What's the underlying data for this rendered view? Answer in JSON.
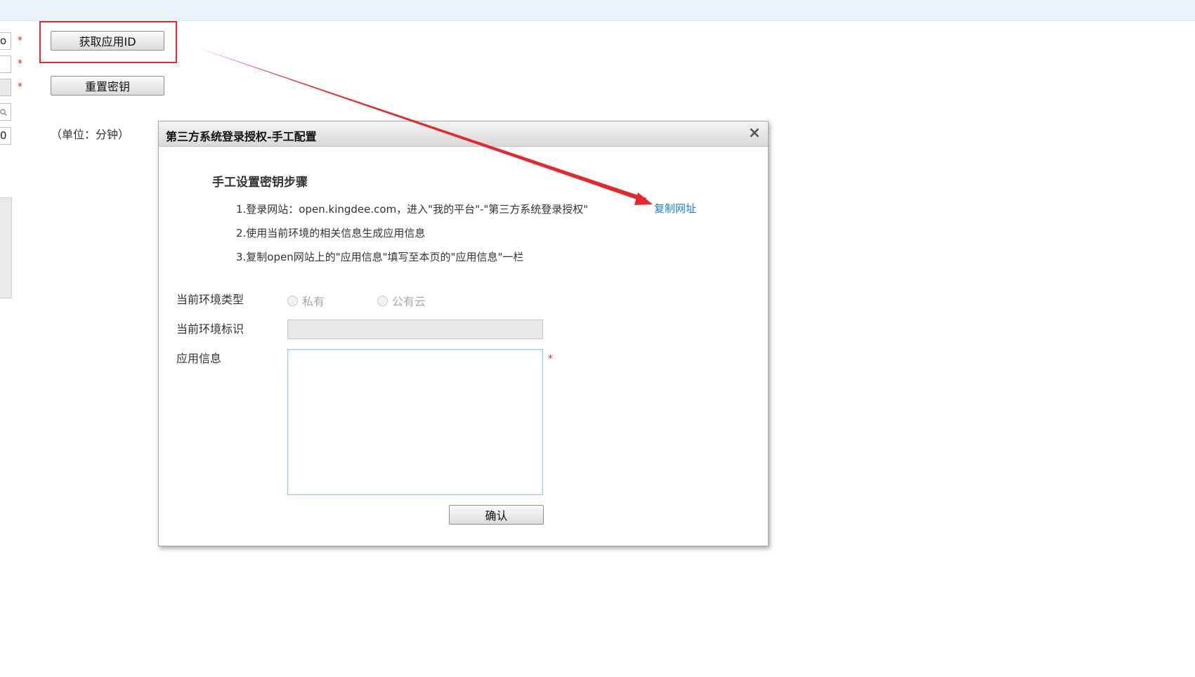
{
  "page": {
    "get_app_id_button": "获取应用ID",
    "reset_secret_button": "重置密钥",
    "unit_label": "（单位：分钟）",
    "stub_values": [
      "o",
      "",
      "",
      "",
      "0"
    ],
    "required_mark": "*"
  },
  "dialog": {
    "title": "第三方系统登录授权-手工配置",
    "close_glyph": "×",
    "steps_heading": "手工设置密钥步骤",
    "steps": [
      "1.登录网站：open.kingdee.com，进入\"我的平台\"-\"第三方系统登录授权\"",
      "2.使用当前环境的相关信息生成应用信息",
      "3.复制open网站上的\"应用信息\"填写至本页的\"应用信息\"一栏"
    ],
    "copy_url_link": "复制网址",
    "env_type_label": "当前环境类型",
    "env_type_options": [
      "私有",
      "公有云"
    ],
    "env_id_label": "当前环境标识",
    "env_id_value": "",
    "app_info_label": "应用信息",
    "app_info_value": "",
    "required_mark": "*",
    "confirm_button": "确认"
  },
  "colors": {
    "annotation_red": "#e4282e",
    "link_blue": "#1a7fd4",
    "top_bar": "#eaf3fa"
  }
}
